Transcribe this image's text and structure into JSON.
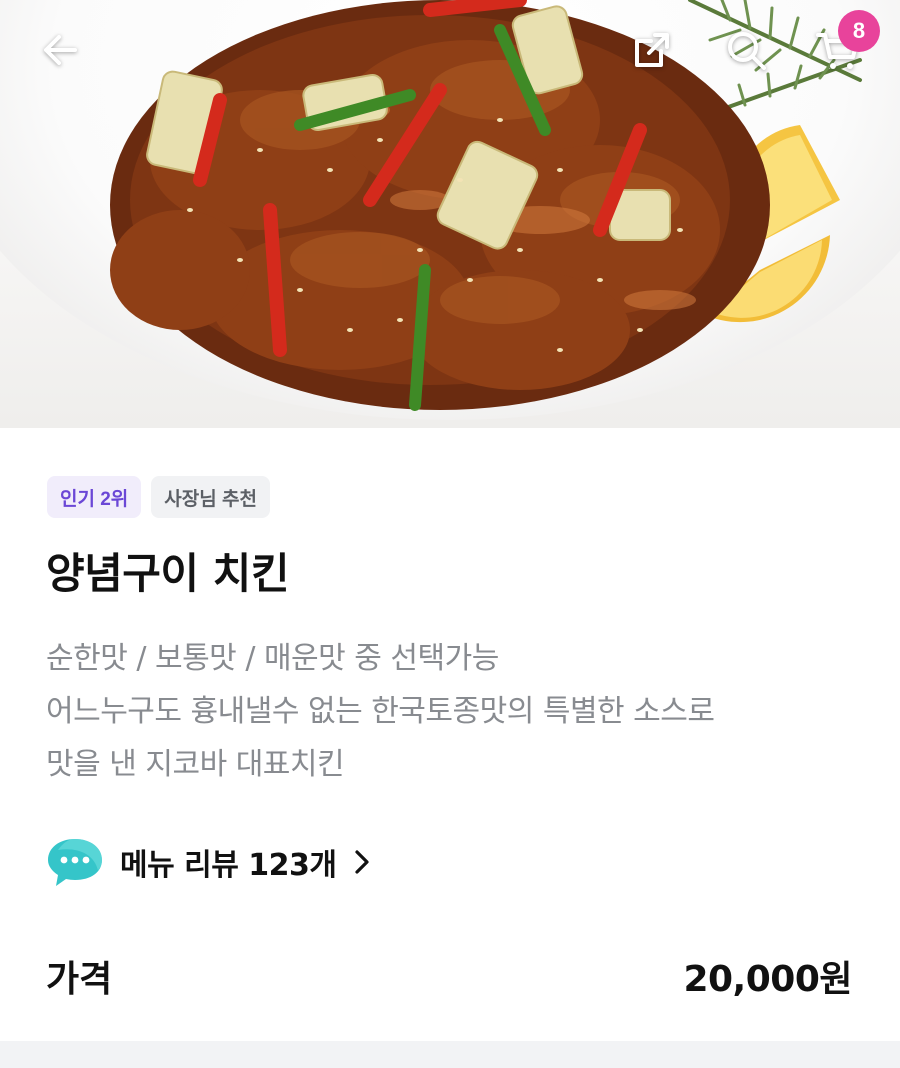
{
  "header": {
    "cart_count": "8",
    "icons": [
      "back-arrow-icon",
      "share-icon",
      "search-icon",
      "cart-icon"
    ]
  },
  "menu": {
    "tags": [
      {
        "label": "인기 2위",
        "color": "#6b47d6",
        "bg": "#f1edfb"
      },
      {
        "label": "사장님 추천",
        "color": "#5c6066",
        "bg": "#f1f2f4"
      }
    ],
    "name": "양념구이 치킨",
    "description_lines": [
      "순한맛 / 보통맛 / 매운맛 중 선택가능",
      "어느누구도 흉내낼수 없는 한국토종맛의 특별한 소스로",
      "맛을 낸 지코바 대표치킨"
    ],
    "review_link": "메뉴 리뷰 123개",
    "price_label": "가격",
    "price": "20,000원"
  },
  "colors": {
    "accent": "#6b47d6",
    "badge": "#e8439b",
    "review_icon": "#35c5c9"
  }
}
